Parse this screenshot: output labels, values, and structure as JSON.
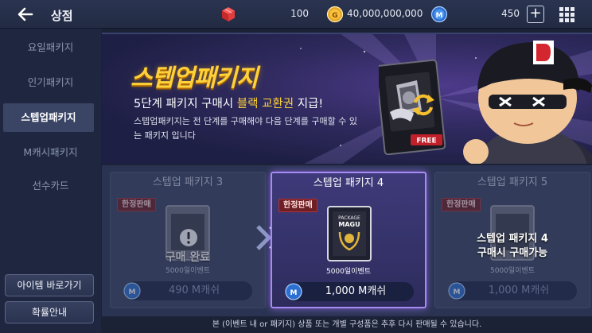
{
  "header": {
    "title": "상점",
    "currencies": [
      {
        "icon": "red-cube-icon",
        "value": "100"
      },
      {
        "icon": "gold-coin-icon",
        "value": "40,000,000,000"
      },
      {
        "icon": "m-cash-icon",
        "value": "450"
      }
    ],
    "plus_label": "+"
  },
  "sidebar": {
    "items": [
      {
        "label": "요일패키지",
        "active": false
      },
      {
        "label": "인기패키지",
        "active": false
      },
      {
        "label": "스텝업패키지",
        "active": true
      },
      {
        "label": "M캐시패키지",
        "active": false
      },
      {
        "label": "선수카드",
        "active": false
      }
    ],
    "shortcut_button": "아이템 바로가기",
    "guide_button": "확률안내"
  },
  "banner": {
    "title": "스텝업패키지",
    "subtitle_prefix": "5단계 패키지 구매시 ",
    "subtitle_highlight": "블랙 교환권",
    "subtitle_suffix": " 지급!",
    "description": "스텝업패키지는 전 단계를 구매해야 다음 단계를 구매할 수 있는 패키지 입니다",
    "card_tag": "FREE"
  },
  "packages": [
    {
      "title": "스텝업 패키지 3",
      "badge": "한정판매",
      "caption": "5000일이벤트",
      "status": "구매 완료",
      "price": "490 M캐쉬",
      "state": "purchased"
    },
    {
      "title": "스텝업 패키지 4",
      "badge": "한정판매",
      "caption": "5000일이벤트",
      "art_text_1": "PACKAGE",
      "art_text_2": "MAGU",
      "price": "1,000 M캐쉬",
      "state": "current"
    },
    {
      "title": "스텝업 패키지 5",
      "badge": "한정판매",
      "caption": "5000일이벤트",
      "lock_line_1": "스텝업 패키지 4",
      "lock_line_2": "구매시 구매가능",
      "price": "1,000 M캐쉬",
      "state": "locked"
    }
  ],
  "footer_note": "본 (이벤트 내 or 패키지) 상품 또는 개별 구성품은 추후 다시 판매될 수 있습니다.",
  "colors": {
    "accent_gold": "#ffd23a",
    "selected_border": "#a98af5",
    "badge_red": "#6c1f24",
    "m_cash_blue": "#3a86e8"
  }
}
